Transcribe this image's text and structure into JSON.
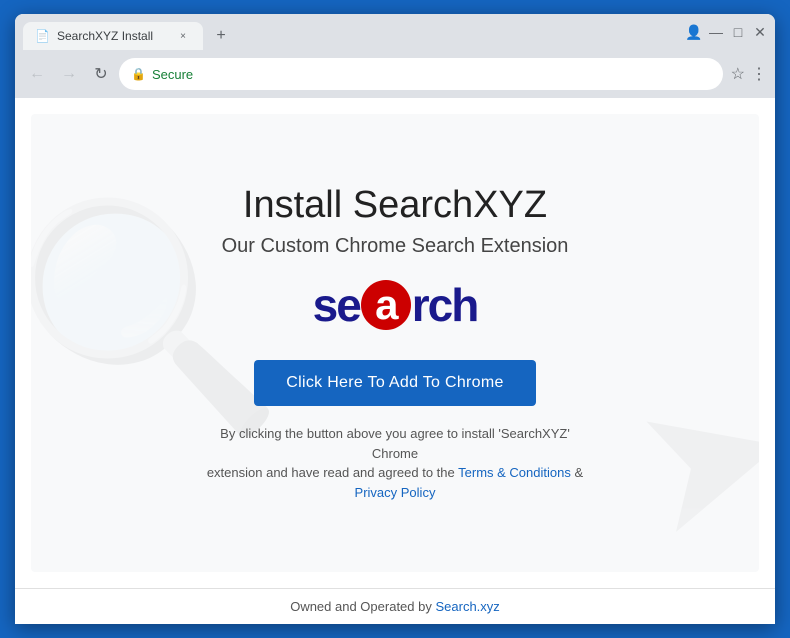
{
  "browser": {
    "tab": {
      "favicon": "📄",
      "title": "SearchXYZ Install",
      "close_label": "×"
    },
    "window_controls": {
      "profile_icon": "👤",
      "minimize": "—",
      "restore": "□",
      "close": "✕"
    },
    "nav": {
      "back": "←",
      "forward": "→",
      "refresh": "↻"
    },
    "address": {
      "secure_icon": "🔒",
      "secure_text": "Secure",
      "url": ""
    },
    "star_icon": "☆",
    "menu_icon": "⋮"
  },
  "page": {
    "title": "Install SearchXYZ",
    "subtitle": "Our Custom Chrome Search Extension",
    "logo": {
      "before": "se",
      "circle_letter": "a",
      "after": "rch"
    },
    "cta_button": "Click Here To Add To Chrome",
    "disclaimer_line1": "By clicking the button above you agree to install 'SearchXYZ' Chrome",
    "disclaimer_line2": "extension and have read and agreed to the",
    "terms_link": "Terms & Conditions",
    "disclaimer_and": "&",
    "privacy_link": "Privacy Policy",
    "footer_text": "Owned and Operated by",
    "footer_link": "Search.xyz"
  }
}
